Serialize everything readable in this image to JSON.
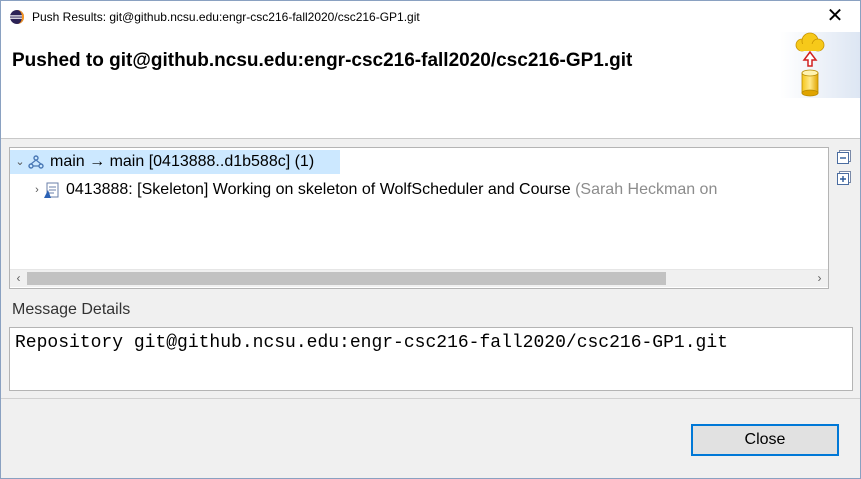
{
  "window": {
    "title": "Push Results: git@github.ncsu.edu:engr-csc216-fall2020/csc216-GP1.git",
    "close_glyph": "✕",
    "icon": "eclipse-icon"
  },
  "header": {
    "title": "Pushed to git@github.ncsu.edu:engr-csc216-fall2020/csc216-GP1.git",
    "image": "cloud-upload-database-icon"
  },
  "tree": {
    "rows": [
      {
        "twisty": "⌄",
        "icon": "branch-icon",
        "label": "main → main [0413888..d1b588c] (1)",
        "selected": true
      },
      {
        "twisty": "›",
        "icon": "commit-icon",
        "label": "0413888: [Skeleton] Working on skeleton of WolfScheduler and Course",
        "author": "(Sarah Heckman on"
      }
    ],
    "scroll_left": "‹",
    "scroll_right": "›"
  },
  "side_buttons": {
    "collapse": "collapse-all-icon",
    "expand": "expand-all-icon"
  },
  "message": {
    "label": "Message Details",
    "text": "Repository git@github.ncsu.edu:engr-csc216-fall2020/csc216-GP1.git"
  },
  "footer": {
    "close_label": "Close"
  }
}
